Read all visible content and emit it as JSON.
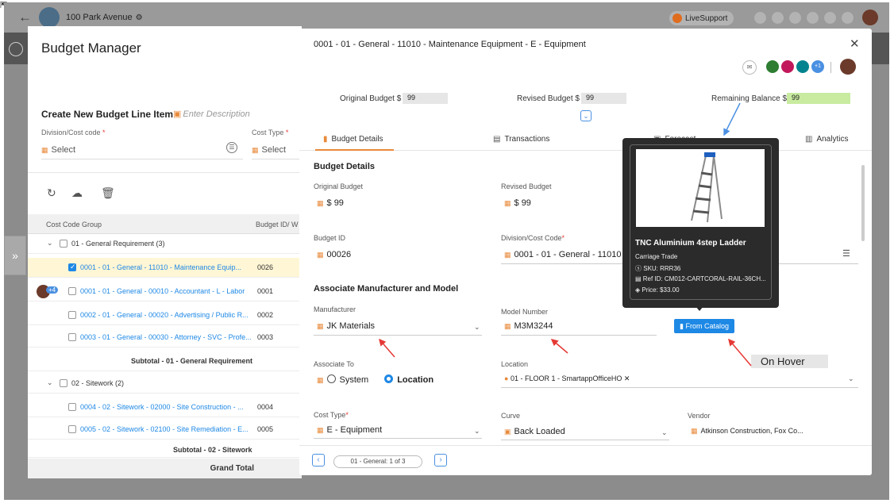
{
  "topbar": {
    "project_name": "100 Park Avenue",
    "live_support": "LiveSupport"
  },
  "budget_manager": {
    "title": "Budget Manager",
    "create_label": "Create New Budget Line Item",
    "description_placeholder": "Enter Description",
    "division_label": "Division/Cost code",
    "cost_type_label": "Cost Type",
    "select_text": "Select",
    "grid_headers": [
      "Cost Code Group",
      "Budget ID/ W"
    ],
    "rows": [
      {
        "type": "group",
        "label": "01 - General Requirement (3)"
      },
      {
        "type": "item",
        "label": "0001 - 01 - General - 11010 - Maintenance Equip...",
        "id": "0026",
        "checked": true,
        "selected": true
      },
      {
        "type": "item",
        "label": "0001 - 01 - General - 00010 - Accountant - L - Labor",
        "id": "0001",
        "checked": false,
        "avatar_badge": "+4"
      },
      {
        "type": "item",
        "label": "0002 - 01 - General - 00020 - Advertising / Public R...",
        "id": "0002",
        "checked": false
      },
      {
        "type": "item",
        "label": "0003 - 01 - General - 00030 - Attorney - SVC - Profe...",
        "id": "0003",
        "checked": false
      },
      {
        "type": "subtotal",
        "label": "Subtotal - 01 - General Requirement"
      },
      {
        "type": "group",
        "label": "02 - Sitework (2)"
      },
      {
        "type": "item",
        "label": "0004 - 02 - Sitework - 02000 - Site Construction - ...",
        "id": "0004",
        "checked": false
      },
      {
        "type": "item",
        "label": "0005 - 02 - Sitework - 02100 - Site Remediation - E...",
        "id": "0005",
        "checked": false
      },
      {
        "type": "subtotal",
        "label": "Subtotal - 02 - Sitework"
      }
    ],
    "grand_total": "Grand Total"
  },
  "detail": {
    "header": "0001 - 01 - General - 11010 - Maintenance Equipment - E - Equipment",
    "avatar_overflow": "+1",
    "original_budget_label": "Original Budget $",
    "original_budget_value": "99",
    "revised_budget_label": "Revised Budget $",
    "revised_budget_value": "99",
    "remaining_balance_label": "Remaining Balance $",
    "remaining_balance_value": "99",
    "tabs": [
      "Budget Details",
      "Transactions",
      "Forecast",
      "Analytics"
    ],
    "section_budget_details": "Budget Details",
    "f_original_budget_label": "Original Budget",
    "f_original_budget_value": "$  99",
    "f_revised_budget_label": "Revised Budget",
    "f_revised_budget_value": "$  99",
    "f_budget_id_label": "Budget ID",
    "f_budget_id_value": "00026",
    "f_division_label": "Division/Cost Code",
    "f_division_value": "0001 - 01 - General - 11010 -",
    "section_manufacturer": "Associate Manufacturer and Model",
    "manufacturer_label": "Manufacturer",
    "manufacturer_value": "JK Materials",
    "model_label": "Model Number",
    "model_value": "M3M3244",
    "from_catalog": "From Catalog",
    "associate_to_label": "Associate To",
    "associate_system": "System",
    "associate_location": "Location",
    "location_label": "Location",
    "location_chip": "01 - FLOOR 1 - SmartappOfficeHO",
    "cost_type_label": "Cost Type",
    "cost_type_value": "E - Equipment",
    "curve_label": "Curve",
    "curve_value": "Back Loaded",
    "vendor_label": "Vendor",
    "vendor_value": "Atkinson Construction, Fox Co...",
    "pager_text": "01 - General: 1 of 3"
  },
  "tooltip": {
    "product_name": "TNC Aluminium 4step Ladder",
    "brand": "Carriage Trade",
    "sku": "SKU: RRR36",
    "ref_id": "Ref ID: CM012-CARTCORAL-RAIL-36CH...",
    "price": "Price: $33.00"
  },
  "annotation": {
    "on_hover": "On Hover"
  },
  "colors": {
    "accent_orange": "#e88a3b",
    "link_blue": "#1e88e5",
    "remaining_green": "#c8eba0",
    "annotation_red": "#e53935"
  }
}
